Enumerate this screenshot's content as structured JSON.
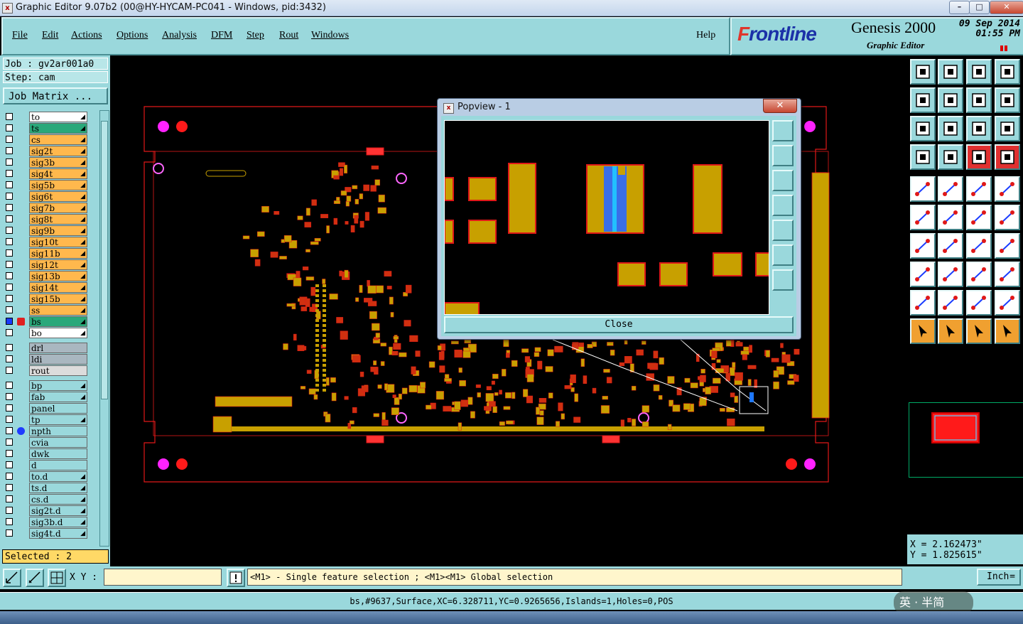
{
  "window": {
    "title": "Graphic Editor 9.07b2 (00@HY-HYCAM-PC041 - Windows, pid:3432)"
  },
  "menu": {
    "items": [
      "File",
      "Edit",
      "Actions",
      "Options",
      "Analysis",
      "DFM",
      "Step",
      "Rout",
      "Windows"
    ],
    "help": "Help"
  },
  "brand": {
    "logo_prefix": "F",
    "logo_rest": "rontline",
    "product": "Genesis 2000",
    "subtitle": "Graphic Editor",
    "date_line1": "09 Sep 2014",
    "date_line2": "01:55 PM"
  },
  "job": {
    "job_label": "Job  : gv2ar001a0",
    "step_label": "Step: cam",
    "matrix_button": "Job Matrix ..."
  },
  "layers": [
    {
      "name": "to",
      "color": "#ffffff",
      "arrow": true
    },
    {
      "name": "ts",
      "color": "#2aa87a",
      "arrow": true
    },
    {
      "name": "cs",
      "color": "#ffb84d",
      "arrow": true
    },
    {
      "name": "sig2t",
      "color": "#ffb84d",
      "arrow": true
    },
    {
      "name": "sig3b",
      "color": "#ffb84d",
      "arrow": true
    },
    {
      "name": "sig4t",
      "color": "#ffb84d",
      "arrow": true
    },
    {
      "name": "sig5b",
      "color": "#ffb84d",
      "arrow": true
    },
    {
      "name": "sig6t",
      "color": "#ffb84d",
      "arrow": true
    },
    {
      "name": "sig7b",
      "color": "#ffb84d",
      "arrow": true
    },
    {
      "name": "sig8t",
      "color": "#ffb84d",
      "arrow": true
    },
    {
      "name": "sig9b",
      "color": "#ffb84d",
      "arrow": true
    },
    {
      "name": "sig10t",
      "color": "#ffb84d",
      "arrow": true
    },
    {
      "name": "sig11b",
      "color": "#ffb84d",
      "arrow": true
    },
    {
      "name": "sig12t",
      "color": "#ffb84d",
      "arrow": true
    },
    {
      "name": "sig13b",
      "color": "#ffb84d",
      "arrow": true
    },
    {
      "name": "sig14t",
      "color": "#ffb84d",
      "arrow": true
    },
    {
      "name": "sig15b",
      "color": "#ffb84d",
      "arrow": true
    },
    {
      "name": "ss",
      "color": "#ffb84d",
      "arrow": true
    },
    {
      "name": "bs",
      "color": "#2aa87a",
      "arrow": true,
      "active": true
    },
    {
      "name": "bo",
      "color": "#ffffff",
      "arrow": true
    },
    {
      "name": "drl",
      "color": "#a9b7c0",
      "arrow": false,
      "gap": true
    },
    {
      "name": "ldi",
      "color": "#a9b7c0",
      "arrow": false
    },
    {
      "name": "rout",
      "color": "#dcdcdc",
      "arrow": false
    },
    {
      "name": "bp",
      "color": "#9ad8dc",
      "arrow": true,
      "gap": true
    },
    {
      "name": "fab",
      "color": "#9ad8dc",
      "arrow": true
    },
    {
      "name": "panel",
      "color": "#9ad8dc",
      "arrow": false
    },
    {
      "name": "tp",
      "color": "#9ad8dc",
      "arrow": true
    },
    {
      "name": "npth",
      "color": "#9ad8dc",
      "arrow": false,
      "mark": "#1f3bff"
    },
    {
      "name": "cvia",
      "color": "#9ad8dc",
      "arrow": false
    },
    {
      "name": "dwk",
      "color": "#9ad8dc",
      "arrow": false
    },
    {
      "name": "d",
      "color": "#9ad8dc",
      "arrow": false
    },
    {
      "name": "to.d",
      "color": "#9ad8dc",
      "arrow": true
    },
    {
      "name": "ts.d",
      "color": "#9ad8dc",
      "arrow": true
    },
    {
      "name": "cs.d",
      "color": "#9ad8dc",
      "arrow": true
    },
    {
      "name": "sig2t.d",
      "color": "#9ad8dc",
      "arrow": true
    },
    {
      "name": "sig3b.d",
      "color": "#9ad8dc",
      "arrow": true
    },
    {
      "name": "sig4t.d",
      "color": "#9ad8dc",
      "arrow": true
    }
  ],
  "selected": "Selected : 2",
  "popview": {
    "title": "Popview - 1",
    "close_label": "Close"
  },
  "coords": {
    "x": "X  = 2.162473\"",
    "y": "Y  = 1.825615\""
  },
  "command": {
    "xy_label": "X Y :",
    "xy_value": "",
    "prompt": "<M1> - Single feature selection ; <M1><M1> Global selection",
    "unit": "Inch"
  },
  "status": {
    "text": "bs,#9637,Surface,XC=6.328711,YC=0.9265656,Islands=1,Holes=0,POS"
  },
  "ime": {
    "text": "英 · 半简"
  },
  "colors": {
    "panel": "#9ad8dc",
    "pad_fill": "#c8a000",
    "outline": "#e01818",
    "accent_magenta": "#ff22ff"
  }
}
